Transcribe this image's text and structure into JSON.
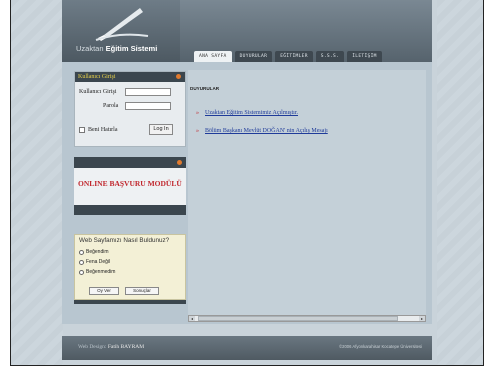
{
  "header": {
    "logo_prefix": "Uzaktan ",
    "logo_bold": "Eğitim Sistemi",
    "nav": [
      "ANA SAYFA",
      "DUYURULAR",
      "EĞİTİMLER",
      "S.S.S.",
      "İLETİŞİM"
    ]
  },
  "login": {
    "title": "Kullanıcı Girişi",
    "username_label": "Kullanıcı Girişi",
    "password_label": "Parola",
    "remember_label": "Beni Hatırla",
    "button": "Log In"
  },
  "online_module": {
    "title": "ONLINE BAŞVURU MODÜLÜ"
  },
  "poll": {
    "question": "Web Sayfamızı Nasıl Buldunuz?",
    "options": [
      "Beğendim",
      "Fena Değil",
      "Beğenmedim"
    ],
    "vote_button": "Oy Ver",
    "results_button": "Sonuçlar"
  },
  "announcements": {
    "title": "DUYURULAR",
    "items": [
      "Uzaktan Eğitim Sistemimiz Açılmıştır.",
      "Bölüm Başkanı Mevlüt DOĞAN' nin Açılış Mesajı"
    ],
    "arrow": "»"
  },
  "footer": {
    "design_label": "Web Design:",
    "designer": "Fatih BAYRAM",
    "copyright": "©2006 Afyonkarahisar Kocatepe Üniversitesi"
  },
  "colors": {
    "accent_red": "#c1272d",
    "link_blue": "#1f3b9a",
    "dark_panel": "#3b464e",
    "highlight_yellow": "#e8d24a"
  }
}
